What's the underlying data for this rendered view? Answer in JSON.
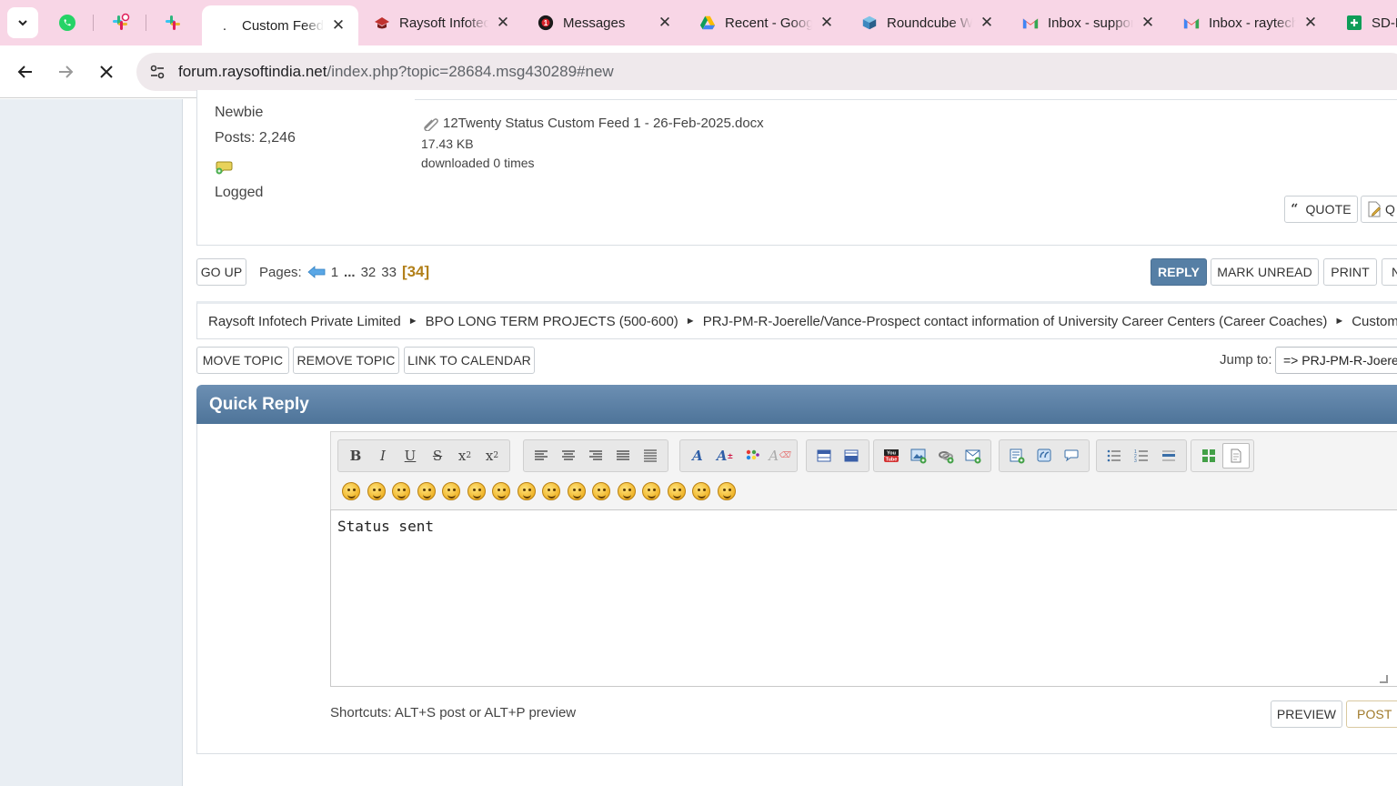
{
  "tabs": {
    "items": [
      {
        "label": "Custom Feed",
        "active": true
      },
      {
        "label": "Raysoft Infotech"
      },
      {
        "label": "Messages"
      },
      {
        "label": "Recent - Google"
      },
      {
        "label": "Roundcube Webmail"
      },
      {
        "label": "Inbox - support"
      },
      {
        "label": "Inbox - raytech"
      },
      {
        "label": "SD-R"
      }
    ],
    "active_prefix": ".",
    "close_glyph": "✕"
  },
  "address": {
    "host": "forum.raysoftindia.net",
    "path": "/index.php?topic=28684.msg430289#new"
  },
  "poster": {
    "rank": "Newbie",
    "posts": "Posts: 2,246",
    "logged": "Logged"
  },
  "attachment": {
    "name": "12Twenty Status Custom Feed 1 - 26-Feb-2025.docx",
    "size": "17.43 KB",
    "downloads": "downloaded 0 times"
  },
  "post_buttons": {
    "quote": "QUOTE",
    "quick_quote": "Q"
  },
  "nav": {
    "go_up": "GO UP",
    "pages_label": "Pages:",
    "pages": [
      "1",
      "...",
      "32",
      "33"
    ],
    "current_page": "[34]",
    "reply": "REPLY",
    "mark_unread": "MARK UNREAD",
    "print": "PRINT",
    "next": "N"
  },
  "breadcrumb": [
    "Raysoft Infotech Private Limited",
    "BPO LONG TERM PROJECTS (500-600)",
    "PRJ-PM-R-Joerelle/Vance-Prospect contact information of University Career Centers (Career Coaches)",
    "Custom Feeds"
  ],
  "topic_actions": {
    "move": "MOVE TOPIC",
    "remove": "REMOVE TOPIC",
    "calendar": "LINK TO CALENDAR"
  },
  "jump": {
    "label": "Jump to:",
    "selected": "=> PRJ-PM-R-Joerelle"
  },
  "quick_reply": {
    "title": "Quick Reply",
    "text": "Status sent",
    "shortcuts": "Shortcuts: ALT+S post or ALT+P preview",
    "preview": "PREVIEW",
    "post": "POST"
  },
  "editor_icons": [
    "bold-icon",
    "italic-icon",
    "underline-icon",
    "strike-icon",
    "superscript-icon",
    "subscript-icon",
    "align-left-icon",
    "center-icon",
    "align-right-icon",
    "justify-icon",
    "indent-icon",
    "font-face-icon",
    "font-size-icon",
    "color-icon",
    "remove-format-icon",
    "table-icon",
    "code-icon",
    "youtube-icon",
    "image-icon",
    "link-icon",
    "email-icon",
    "insert-icon",
    "quote-icon",
    "speech-icon",
    "bullet-list-icon",
    "numbered-list-icon",
    "horizontal-rule-icon",
    "smiley-grid-icon",
    "source-icon"
  ],
  "colors": {
    "tab_bg": "#f8d6e6",
    "accent": "#567fa5",
    "current_page": "#b2801a"
  }
}
